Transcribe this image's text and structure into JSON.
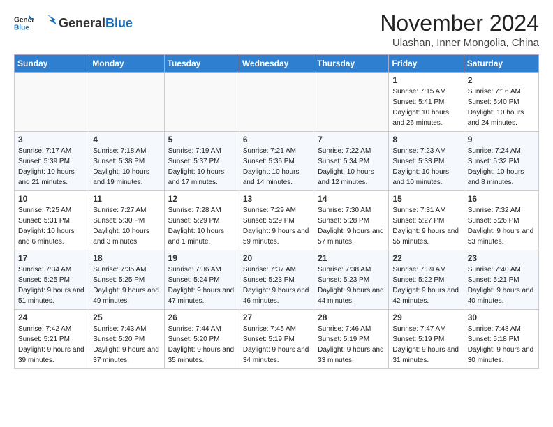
{
  "header": {
    "logo_general": "General",
    "logo_blue": "Blue",
    "month": "November 2024",
    "location": "Ulashan, Inner Mongolia, China"
  },
  "weekdays": [
    "Sunday",
    "Monday",
    "Tuesday",
    "Wednesday",
    "Thursday",
    "Friday",
    "Saturday"
  ],
  "weeks": [
    [
      {
        "day": "",
        "info": ""
      },
      {
        "day": "",
        "info": ""
      },
      {
        "day": "",
        "info": ""
      },
      {
        "day": "",
        "info": ""
      },
      {
        "day": "",
        "info": ""
      },
      {
        "day": "1",
        "info": "Sunrise: 7:15 AM\nSunset: 5:41 PM\nDaylight: 10 hours and 26 minutes."
      },
      {
        "day": "2",
        "info": "Sunrise: 7:16 AM\nSunset: 5:40 PM\nDaylight: 10 hours and 24 minutes."
      }
    ],
    [
      {
        "day": "3",
        "info": "Sunrise: 7:17 AM\nSunset: 5:39 PM\nDaylight: 10 hours and 21 minutes."
      },
      {
        "day": "4",
        "info": "Sunrise: 7:18 AM\nSunset: 5:38 PM\nDaylight: 10 hours and 19 minutes."
      },
      {
        "day": "5",
        "info": "Sunrise: 7:19 AM\nSunset: 5:37 PM\nDaylight: 10 hours and 17 minutes."
      },
      {
        "day": "6",
        "info": "Sunrise: 7:21 AM\nSunset: 5:36 PM\nDaylight: 10 hours and 14 minutes."
      },
      {
        "day": "7",
        "info": "Sunrise: 7:22 AM\nSunset: 5:34 PM\nDaylight: 10 hours and 12 minutes."
      },
      {
        "day": "8",
        "info": "Sunrise: 7:23 AM\nSunset: 5:33 PM\nDaylight: 10 hours and 10 minutes."
      },
      {
        "day": "9",
        "info": "Sunrise: 7:24 AM\nSunset: 5:32 PM\nDaylight: 10 hours and 8 minutes."
      }
    ],
    [
      {
        "day": "10",
        "info": "Sunrise: 7:25 AM\nSunset: 5:31 PM\nDaylight: 10 hours and 6 minutes."
      },
      {
        "day": "11",
        "info": "Sunrise: 7:27 AM\nSunset: 5:30 PM\nDaylight: 10 hours and 3 minutes."
      },
      {
        "day": "12",
        "info": "Sunrise: 7:28 AM\nSunset: 5:29 PM\nDaylight: 10 hours and 1 minute."
      },
      {
        "day": "13",
        "info": "Sunrise: 7:29 AM\nSunset: 5:29 PM\nDaylight: 9 hours and 59 minutes."
      },
      {
        "day": "14",
        "info": "Sunrise: 7:30 AM\nSunset: 5:28 PM\nDaylight: 9 hours and 57 minutes."
      },
      {
        "day": "15",
        "info": "Sunrise: 7:31 AM\nSunset: 5:27 PM\nDaylight: 9 hours and 55 minutes."
      },
      {
        "day": "16",
        "info": "Sunrise: 7:32 AM\nSunset: 5:26 PM\nDaylight: 9 hours and 53 minutes."
      }
    ],
    [
      {
        "day": "17",
        "info": "Sunrise: 7:34 AM\nSunset: 5:25 PM\nDaylight: 9 hours and 51 minutes."
      },
      {
        "day": "18",
        "info": "Sunrise: 7:35 AM\nSunset: 5:25 PM\nDaylight: 9 hours and 49 minutes."
      },
      {
        "day": "19",
        "info": "Sunrise: 7:36 AM\nSunset: 5:24 PM\nDaylight: 9 hours and 47 minutes."
      },
      {
        "day": "20",
        "info": "Sunrise: 7:37 AM\nSunset: 5:23 PM\nDaylight: 9 hours and 46 minutes."
      },
      {
        "day": "21",
        "info": "Sunrise: 7:38 AM\nSunset: 5:23 PM\nDaylight: 9 hours and 44 minutes."
      },
      {
        "day": "22",
        "info": "Sunrise: 7:39 AM\nSunset: 5:22 PM\nDaylight: 9 hours and 42 minutes."
      },
      {
        "day": "23",
        "info": "Sunrise: 7:40 AM\nSunset: 5:21 PM\nDaylight: 9 hours and 40 minutes."
      }
    ],
    [
      {
        "day": "24",
        "info": "Sunrise: 7:42 AM\nSunset: 5:21 PM\nDaylight: 9 hours and 39 minutes."
      },
      {
        "day": "25",
        "info": "Sunrise: 7:43 AM\nSunset: 5:20 PM\nDaylight: 9 hours and 37 minutes."
      },
      {
        "day": "26",
        "info": "Sunrise: 7:44 AM\nSunset: 5:20 PM\nDaylight: 9 hours and 35 minutes."
      },
      {
        "day": "27",
        "info": "Sunrise: 7:45 AM\nSunset: 5:19 PM\nDaylight: 9 hours and 34 minutes."
      },
      {
        "day": "28",
        "info": "Sunrise: 7:46 AM\nSunset: 5:19 PM\nDaylight: 9 hours and 33 minutes."
      },
      {
        "day": "29",
        "info": "Sunrise: 7:47 AM\nSunset: 5:19 PM\nDaylight: 9 hours and 31 minutes."
      },
      {
        "day": "30",
        "info": "Sunrise: 7:48 AM\nSunset: 5:18 PM\nDaylight: 9 hours and 30 minutes."
      }
    ]
  ]
}
